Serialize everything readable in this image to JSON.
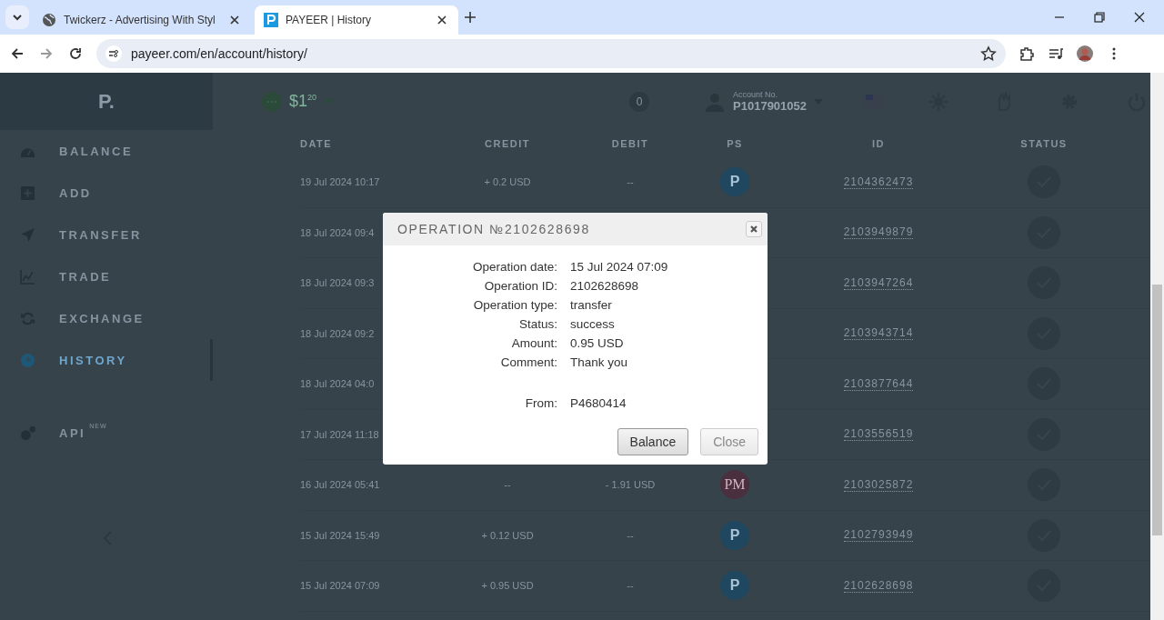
{
  "browser": {
    "tabs": [
      {
        "title": "Twickerz - Advertising With Styl",
        "kind": "globe",
        "selected": false
      },
      {
        "title": "PAYEER | History",
        "kind": "payeer",
        "selected": true
      }
    ],
    "url": "payeer.com/en/account/history/"
  },
  "sidebar": {
    "logo": "P.",
    "items": [
      {
        "label": "BALANCE",
        "kind": "gauge",
        "selected": false
      },
      {
        "label": "ADD",
        "kind": "plus",
        "selected": false
      },
      {
        "label": "TRANSFER",
        "kind": "plane",
        "selected": false
      },
      {
        "label": "TRADE",
        "kind": "chart",
        "selected": false
      },
      {
        "label": "EXCHANGE",
        "kind": "cycle",
        "selected": false
      },
      {
        "label": "HISTORY",
        "kind": "clock",
        "selected": true
      }
    ],
    "api": {
      "label": "API",
      "badge": "NEW"
    }
  },
  "header": {
    "balance": "$1",
    "balance_cents": "20",
    "notifications": "0",
    "account_label": "Account No.",
    "account": "P1017901052"
  },
  "table": {
    "columns": [
      "DATE",
      "CREDIT",
      "DEBIT",
      "PS",
      "ID",
      "STATUS"
    ],
    "rows": [
      {
        "date": "19 Jul 2024 10:17",
        "credit": "+ 0.2 USD",
        "debit": "--",
        "ps": "P",
        "color": "#1f4760",
        "id": "2104362473"
      },
      {
        "date": "18 Jul 2024 09:4",
        "id": "2103949879"
      },
      {
        "date": "18 Jul 2024 09:3",
        "id": "2103947264"
      },
      {
        "date": "18 Jul 2024 09:2",
        "id": "2103943714"
      },
      {
        "date": "18 Jul 2024 04:0",
        "id": "2103877644"
      },
      {
        "date": "17 Jul 2024 11:18",
        "id": "2103556519"
      },
      {
        "date": "16 Jul 2024 05:41",
        "credit": "--",
        "debit": "- 1.91 USD",
        "ps": "PM",
        "color": "#4a2f3f",
        "id": "2103025872"
      },
      {
        "date": "15 Jul 2024 15:49",
        "credit": "+ 0.12 USD",
        "debit": "--",
        "ps": "P",
        "color": "#1f4760",
        "id": "2102793949"
      },
      {
        "date": "15 Jul 2024 07:09",
        "credit": "+ 0.95 USD",
        "debit": "--",
        "ps": "P",
        "color": "#1f4760",
        "id": "2102628698"
      }
    ]
  },
  "modal": {
    "title": "OPERATION №2102628698",
    "sections": [
      [
        {
          "label": "Operation date:",
          "value": "15 Jul 2024 07:09"
        },
        {
          "label": "Operation ID:",
          "value": "2102628698"
        },
        {
          "label": "Operation type:",
          "value": "transfer"
        },
        {
          "label": "Status:",
          "value": "success"
        },
        {
          "label": "Amount:",
          "value": "0.95 USD"
        },
        {
          "label": "Comment:",
          "value": "Thank you"
        }
      ],
      [
        {
          "label": "From:",
          "value": "P4680414"
        }
      ]
    ],
    "buttons": [
      {
        "label": "Balance",
        "primary": true
      },
      {
        "label": "Close",
        "primary": false
      }
    ]
  }
}
